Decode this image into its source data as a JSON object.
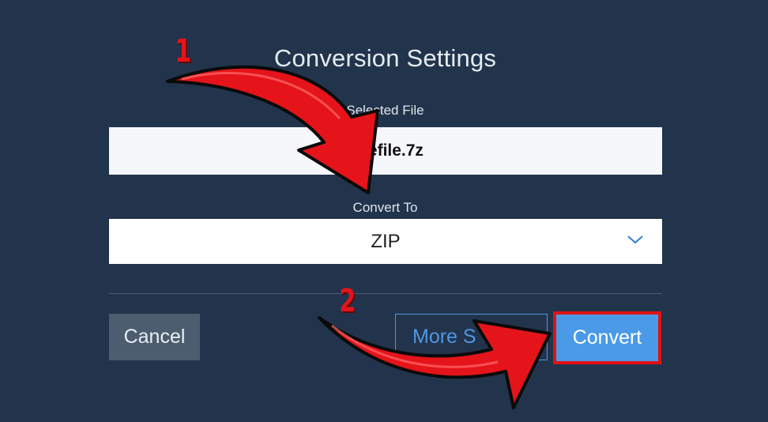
{
  "dialog": {
    "title": "Conversion Settings",
    "selected_file_label": "Selected File",
    "selected_file_value": "samplefile.7z",
    "selected_file_visible_text": "lefile.7z",
    "convert_to_label": "Convert To",
    "convert_to_value": "ZIP",
    "cancel_label": "Cancel",
    "more_settings_label": "More Settings",
    "more_settings_visible_text": "More S",
    "convert_label": "Convert"
  },
  "annotations": {
    "step1_number": "1",
    "step2_number": "2",
    "arrow_color": "#e4141a",
    "highlight_color": "#e11212"
  },
  "colors": {
    "background": "#22344b",
    "accent": "#4a9ae8",
    "cancel_button": "#4c5d70"
  },
  "icons": {
    "dropdown": "chevron-down-icon"
  }
}
